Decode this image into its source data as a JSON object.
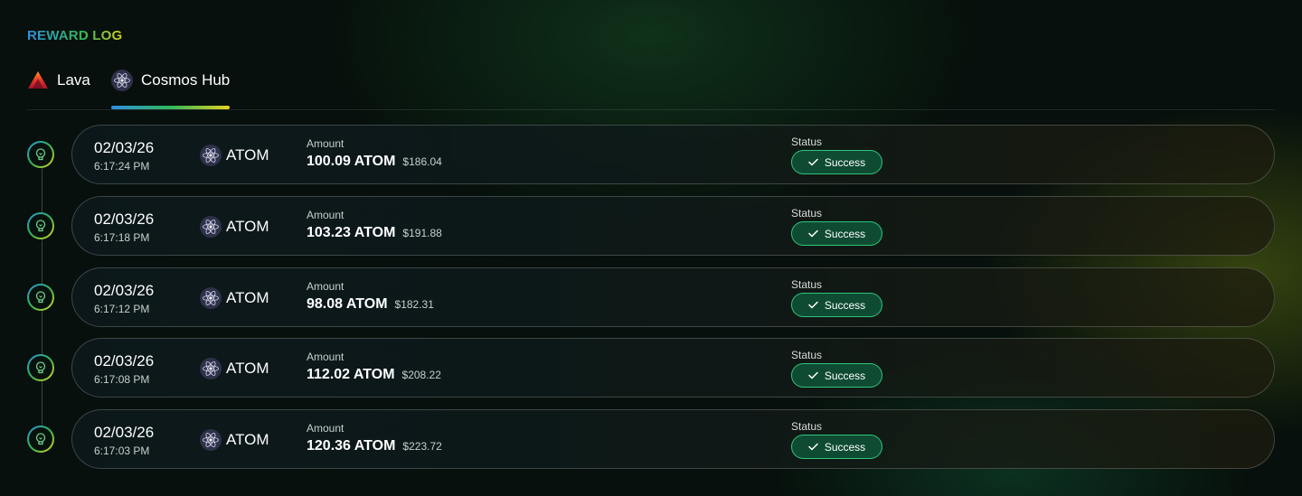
{
  "page": {
    "title": "REWARD LOG"
  },
  "tabs": [
    {
      "label": "Lava",
      "icon": "lava-logo-icon",
      "active": false
    },
    {
      "label": "Cosmos Hub",
      "icon": "cosmos-hub-logo-icon",
      "active": true
    }
  ],
  "colors": {
    "accent_gradient": [
      "#2f8fe0",
      "#2fb85a",
      "#e8d11e"
    ],
    "success_border": "#2fc57a",
    "success_fill": "#0f4b33"
  },
  "rewards": [
    {
      "date": "02/03/26",
      "time": "6:17:24 PM",
      "token": "ATOM",
      "amount_label": "Amount",
      "amount": "100.09 ATOM",
      "usd": "$186.04",
      "status_label": "Status",
      "status": "Success"
    },
    {
      "date": "02/03/26",
      "time": "6:17:18 PM",
      "token": "ATOM",
      "amount_label": "Amount",
      "amount": "103.23 ATOM",
      "usd": "$191.88",
      "status_label": "Status",
      "status": "Success"
    },
    {
      "date": "02/03/26",
      "time": "6:17:12 PM",
      "token": "ATOM",
      "amount_label": "Amount",
      "amount": "98.08 ATOM",
      "usd": "$182.31",
      "status_label": "Status",
      "status": "Success"
    },
    {
      "date": "02/03/26",
      "time": "6:17:08 PM",
      "token": "ATOM",
      "amount_label": "Amount",
      "amount": "112.02 ATOM",
      "usd": "$208.22",
      "status_label": "Status",
      "status": "Success"
    },
    {
      "date": "02/03/26",
      "time": "6:17:03 PM",
      "token": "ATOM",
      "amount_label": "Amount",
      "amount": "120.36 ATOM",
      "usd": "$223.72",
      "status_label": "Status",
      "status": "Success"
    }
  ]
}
